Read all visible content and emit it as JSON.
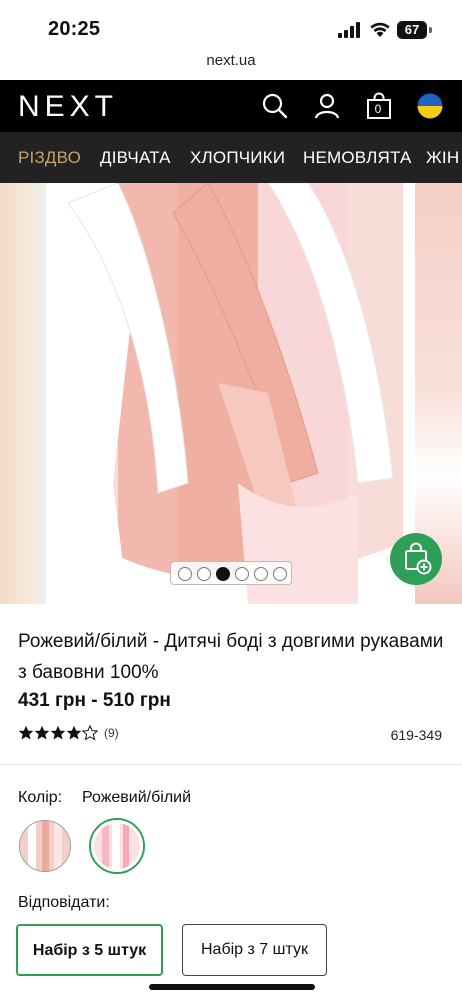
{
  "status": {
    "time": "20:25",
    "battery": "67"
  },
  "browser": {
    "url": "next.ua"
  },
  "header": {
    "logo": "NEXT",
    "bag_count": "0"
  },
  "nav": {
    "items": [
      {
        "label": "РІЗДВО",
        "active": true
      },
      {
        "label": "ДІВЧАТА"
      },
      {
        "label": "ХЛОПЧИКИ"
      },
      {
        "label": "НЕМОВЛЯТА"
      },
      {
        "label": "ЖІН"
      }
    ]
  },
  "gallery": {
    "dot_count": 6,
    "active_dot": 3
  },
  "product": {
    "title": "Рожевий/білий - Дитячі боді з довгими рукавами з бавовни 100%",
    "price": "431 грн - 510 грн",
    "rating": 4.5,
    "review_count": "(9)",
    "sku": "619-349"
  },
  "colour": {
    "label": "Колір:",
    "value": "Рожевий/білий"
  },
  "respond": {
    "label": "Відповідати:",
    "options": [
      {
        "label": "Набір з 5 штук",
        "selected": true
      },
      {
        "label": "Набір з 7 штук",
        "selected": false
      }
    ]
  },
  "colors": {
    "accent_green": "#2f9e56",
    "nav_bg": "#222222",
    "nav_active": "#c9a36a"
  }
}
